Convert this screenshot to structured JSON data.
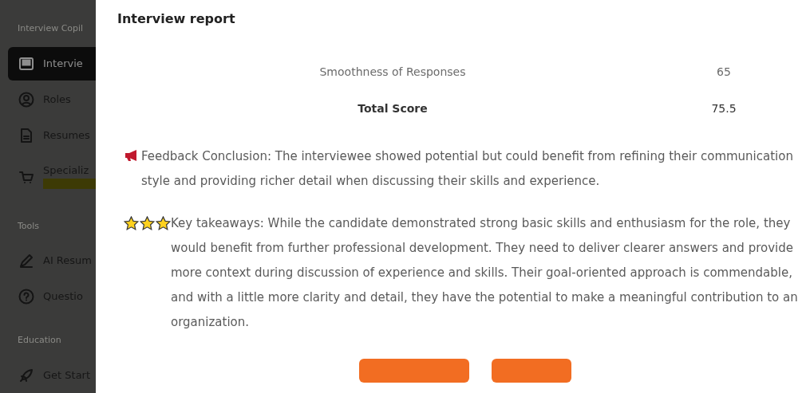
{
  "sidebar": {
    "sections": [
      {
        "heading": "Interview Copil",
        "items": [
          {
            "label": "Intervie",
            "selected": true
          },
          {
            "label": "Roles",
            "selected": false
          },
          {
            "label": "Resumes",
            "selected": false
          },
          {
            "label": "Specializ",
            "selected": false,
            "tag": true
          }
        ]
      },
      {
        "heading": "Tools",
        "items": [
          {
            "label": "AI Resum",
            "selected": false
          },
          {
            "label": "Questio",
            "selected": false
          }
        ]
      },
      {
        "heading": "Education",
        "items": [
          {
            "label": "Get Start",
            "selected": false
          }
        ]
      }
    ]
  },
  "dialog": {
    "title": "Interview report",
    "scores": [
      {
        "label": "Smoothness of Responses",
        "value": "65",
        "kind": "item"
      },
      {
        "label": "Total Score",
        "value": "75.5",
        "kind": "total"
      }
    ],
    "sections": [
      {
        "kind": "megaphone",
        "text": "Feedback Conclusion: The interviewee showed potential but could benefit from refining their communication style and providing richer detail when discussing their skills and experience."
      },
      {
        "kind": "stars",
        "text": "Key takeaways: While the candidate demonstrated strong basic skills and enthusiasm for the role, they would benefit from further professional development. They need to deliver clearer answers and provide more context during discussion of experience and skills. Their goal-oriented approach is commendable, and with a little more clarity and detail, they have the potential to make a meaningful contribution to an organization."
      }
    ],
    "buttons": [
      {
        "kind": "wide"
      },
      {
        "kind": "narrow"
      }
    ]
  }
}
